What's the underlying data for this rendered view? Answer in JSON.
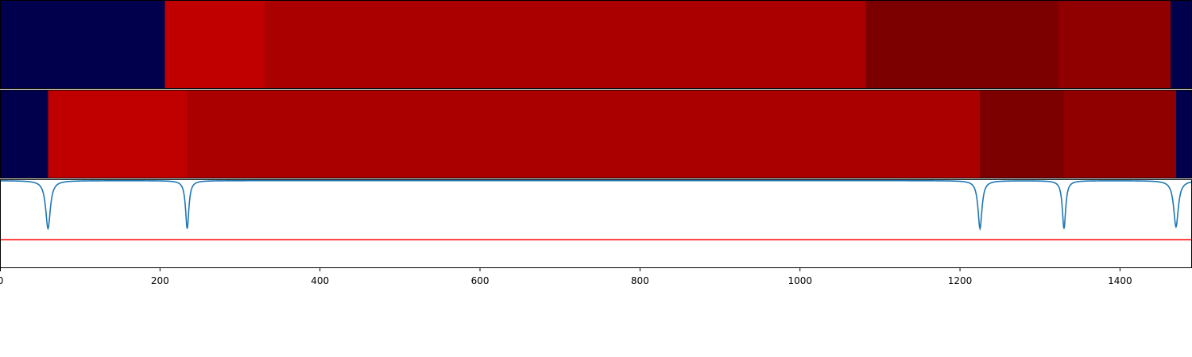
{
  "chart_data": [
    {
      "type": "heatmap",
      "xlim": [
        0,
        1490
      ],
      "segments": [
        {
          "start": 0,
          "end": 206,
          "color": "#00004c"
        },
        {
          "start": 206,
          "end": 331,
          "color": "#c00000"
        },
        {
          "start": 331,
          "end": 1082,
          "color": "#aa0000"
        },
        {
          "start": 1082,
          "end": 1323,
          "color": "#7c0000"
        },
        {
          "start": 1323,
          "end": 1463,
          "color": "#900000"
        },
        {
          "start": 1463,
          "end": 1490,
          "color": "#00004c"
        }
      ]
    },
    {
      "type": "heatmap",
      "xlim": [
        0,
        1490
      ],
      "segments": [
        {
          "start": 0,
          "end": 60,
          "color": "#00004c"
        },
        {
          "start": 60,
          "end": 234,
          "color": "#c00000"
        },
        {
          "start": 234,
          "end": 1225,
          "color": "#aa0000"
        },
        {
          "start": 1225,
          "end": 1330,
          "color": "#7c0000"
        },
        {
          "start": 1330,
          "end": 1470,
          "color": "#900000"
        },
        {
          "start": 1470,
          "end": 1490,
          "color": "#00004c"
        }
      ]
    },
    {
      "type": "line",
      "xlim": [
        0,
        1490
      ],
      "ylim": [
        0,
        1
      ],
      "grid": false,
      "x_ticks": [
        0,
        200,
        400,
        600,
        800,
        1000,
        1200,
        1400
      ],
      "x_tick_labels": [
        "0",
        "200",
        "400",
        "600",
        "800",
        "1000",
        "1200",
        "1400"
      ],
      "series": [
        {
          "color": "#1f77b4",
          "baseline": 0.985,
          "dips": [
            {
              "x": 60,
              "depth": 0.54,
              "width": 3.5
            },
            {
              "x": 234,
              "depth": 0.54,
              "width": 2.5
            },
            {
              "x": 1225,
              "depth": 0.54,
              "width": 3.0
            },
            {
              "x": 1330,
              "depth": 0.54,
              "width": 2.5
            },
            {
              "x": 1470,
              "depth": 0.52,
              "width": 3.5
            }
          ]
        }
      ],
      "threshold": {
        "y": 0.32,
        "color": "#ff0000"
      }
    }
  ]
}
